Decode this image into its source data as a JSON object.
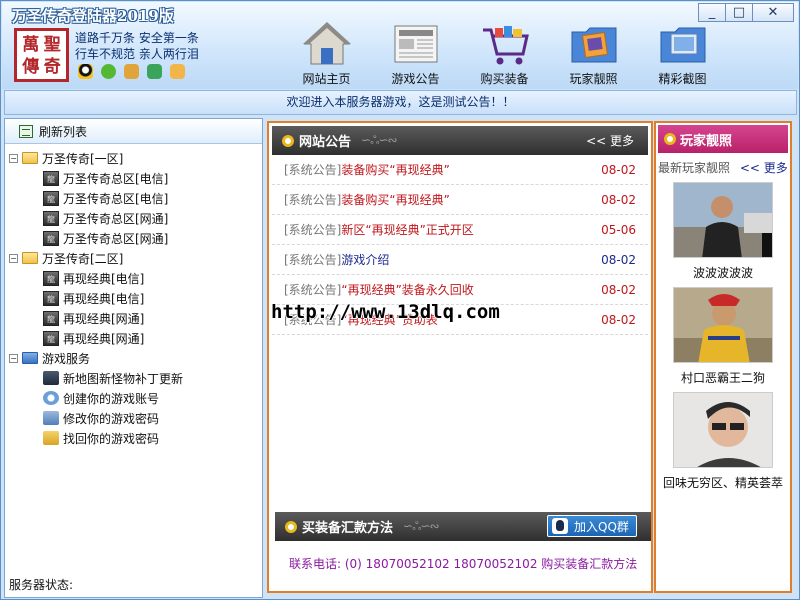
{
  "window": {
    "title": "万圣传奇登陆器2019版",
    "controls": [
      "_",
      "□",
      "✕"
    ]
  },
  "brand": {
    "logo_chars": [
      "萬",
      "聖",
      "傳",
      "奇"
    ],
    "slogan_line1": "道路千万条 安全第一条",
    "slogan_line2": "行车不规范 亲人两行泪",
    "social_icons": [
      "qq-icon",
      "wechat-icon",
      "game-icon",
      "phone-icon",
      "mail-icon"
    ]
  },
  "nav": [
    {
      "label": "网站主页",
      "icon": "home-icon"
    },
    {
      "label": "游戏公告",
      "icon": "newspaper-icon"
    },
    {
      "label": "购买装备",
      "icon": "shopping-cart-icon"
    },
    {
      "label": "玩家靓照",
      "icon": "photo-folder-icon"
    },
    {
      "label": "精彩截图",
      "icon": "screenshot-folder-icon"
    }
  ],
  "announcement": "欢迎进入本服务器游戏，这是测试公告！！",
  "sidebar": {
    "refresh_label": "刷新列表",
    "groups": [
      {
        "label": "万圣传奇[一区]",
        "items": [
          "万圣传奇总区[电信]",
          "万圣传奇总区[电信]",
          "万圣传奇总区[网通]",
          "万圣传奇总区[网通]"
        ]
      },
      {
        "label": "万圣传奇[二区]",
        "items": [
          "再现经典[电信]",
          "再现经典[电信]",
          "再现经典[网通]",
          "再现经典[网通]"
        ]
      },
      {
        "label": "游戏服务",
        "items": [
          "新地图新怪物补丁更新",
          "创建你的游戏账号",
          "修改你的游戏密码",
          "找回你的游戏密码"
        ]
      }
    ],
    "status_label": "服务器状态:"
  },
  "news_panel": {
    "title": "网站公告",
    "more": "<< 更多",
    "items": [
      {
        "cat": "[系统公告]",
        "title": "装备购买“再现经典”",
        "date": "08-02",
        "color": "red"
      },
      {
        "cat": "[系统公告]",
        "title": "装备购买“再现经典”",
        "date": "08-02",
        "color": "red"
      },
      {
        "cat": "[系统公告]",
        "title": "新区“再现经典”正式开区",
        "date": "05-06",
        "color": "red"
      },
      {
        "cat": "[系统公告]",
        "title": "游戏介绍",
        "date": "08-02",
        "color": "blue"
      },
      {
        "cat": "[系统公告]",
        "title": "“再现经典”装备永久回收",
        "date": "08-02",
        "color": "red"
      },
      {
        "cat": "[系统公告]",
        "title": "“再现经典”赞助表",
        "date": "08-02",
        "color": "red"
      }
    ],
    "watermark_url": "http://www.13dlq.com"
  },
  "payment_panel": {
    "title": "买装备汇款方法",
    "qq_button": "加入QQ群",
    "contact": "联系电话: (0) 18070052102 18070052102 购买装备汇款方法"
  },
  "players_panel": {
    "title": "玩家靓照",
    "subtitle": "最新玩家靓照",
    "more": "<< 更多",
    "photos": [
      {
        "caption": "波波波波波"
      },
      {
        "caption": "村口恶霸王二狗"
      },
      {
        "caption": "回味无穷区、精英荟萃"
      }
    ]
  },
  "colors": {
    "accent_orange": "#e07e2c",
    "news_red": "#c0161b",
    "news_blue": "#1a2a8f",
    "contact_purple": "#8a1aa0",
    "player_header_pink": "#c3317a"
  }
}
